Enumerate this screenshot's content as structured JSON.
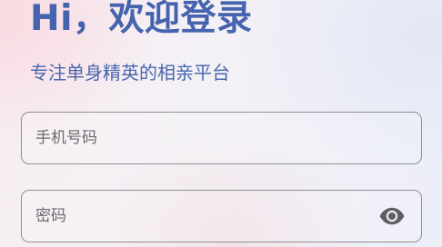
{
  "header": {
    "title": "Hi，欢迎登录",
    "subtitle": "专注单身精英的相亲平台"
  },
  "form": {
    "phone": {
      "placeholder": "手机号码",
      "value": ""
    },
    "password": {
      "placeholder": "密码",
      "value": "",
      "toggle_icon": "eye-icon"
    }
  },
  "colors": {
    "accent": "#4664ad",
    "field_border": "#8f8f93",
    "placeholder": "#6a6a6e",
    "icon": "#5e5e62"
  }
}
